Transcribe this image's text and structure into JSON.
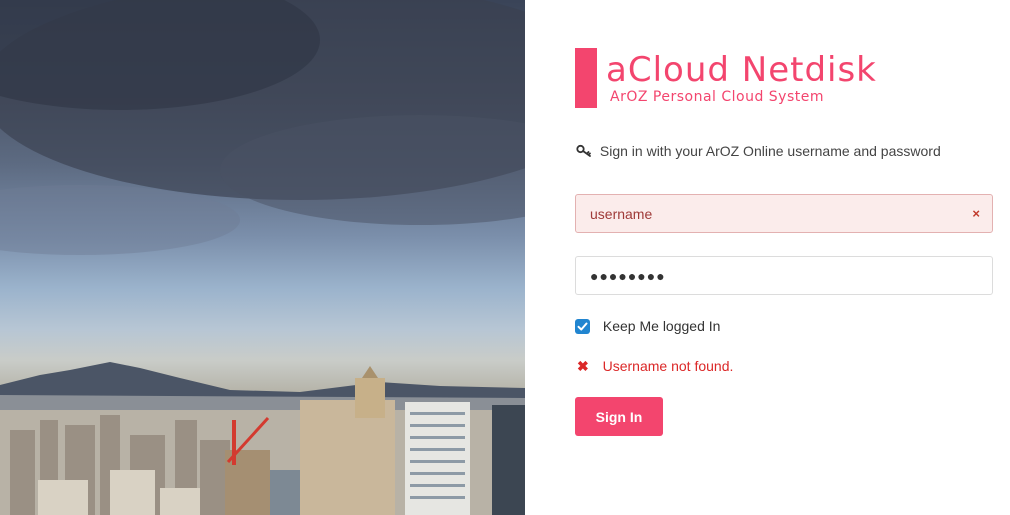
{
  "brand": {
    "title": "aCloud Netdisk",
    "subtitle": "ArOZ Personal Cloud System",
    "accent_color": "#f3456e"
  },
  "login": {
    "hint_icon": "key-icon",
    "hint": "Sign in with your ArOZ Online username and password",
    "username": {
      "placeholder": "username",
      "value": "",
      "clear_icon": "×"
    },
    "password": {
      "value": "●●●●●●●●"
    },
    "remember": {
      "label": "Keep Me logged In",
      "checked": true
    },
    "error": {
      "icon": "✖",
      "message": "Username not found."
    },
    "submit_label": "Sign In"
  },
  "hero": {
    "image": "city-skyline-photo"
  }
}
